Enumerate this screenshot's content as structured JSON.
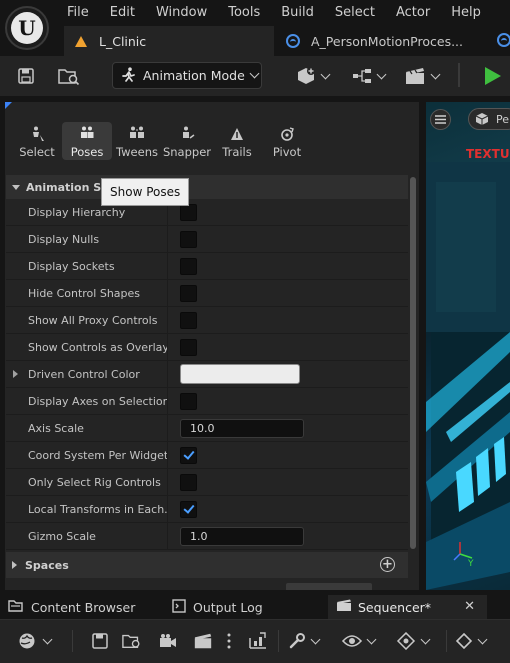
{
  "menu": [
    "File",
    "Edit",
    "Window",
    "Tools",
    "Build",
    "Select",
    "Actor",
    "Help"
  ],
  "doc_tabs": [
    {
      "label": "L_Clinic",
      "icon": "level-icon",
      "color": "#f1a230"
    },
    {
      "label": "A_PersonMotionProces...",
      "icon": "blueprint-icon",
      "color": "#4a8fe7"
    }
  ],
  "toolbar": {
    "mode_label": "Animation Mode"
  },
  "tools": [
    {
      "label": "Select",
      "icon": "select-icon"
    },
    {
      "label": "Poses",
      "icon": "poses-icon",
      "active": true
    },
    {
      "label": "Tweens",
      "icon": "tweens-icon"
    },
    {
      "label": "Snapper",
      "icon": "snapper-icon"
    },
    {
      "label": "Trails",
      "icon": "trails-icon"
    },
    {
      "label": "Pivot",
      "icon": "pivot-icon"
    }
  ],
  "details": {
    "section_title": "Animation Set",
    "tooltip": "Show Poses",
    "rows": [
      {
        "label": "Display Hierarchy",
        "type": "check",
        "value": false
      },
      {
        "label": "Display Nulls",
        "type": "check",
        "value": false
      },
      {
        "label": "Display Sockets",
        "type": "check",
        "value": false
      },
      {
        "label": "Hide Control Shapes",
        "type": "check",
        "value": false
      },
      {
        "label": "Show All Proxy Controls",
        "type": "check",
        "value": false
      },
      {
        "label": "Show Controls as Overlay",
        "type": "check",
        "value": false
      },
      {
        "label": "Driven Control Color",
        "type": "color",
        "value": "#ececec"
      },
      {
        "label": "Display Axes on Selection",
        "type": "check",
        "value": false
      },
      {
        "label": "Axis Scale",
        "type": "number",
        "value": "10.0"
      },
      {
        "label": "Coord System Per Widget...",
        "type": "check",
        "value": true
      },
      {
        "label": "Only Select Rig Controls",
        "type": "check",
        "value": false
      },
      {
        "label": "Local Transforms in Each...",
        "type": "check",
        "value": true
      },
      {
        "label": "Gizmo Scale",
        "type": "number",
        "value": "1.0"
      }
    ],
    "spaces_label": "Spaces"
  },
  "viewport": {
    "persp_label": "Pe",
    "overlay_text": "TEXTUR"
  },
  "bottom_tabs": {
    "content_browser": "Content Browser",
    "output_log": "Output Log",
    "sequencer": "Sequencer*"
  },
  "colors": {
    "accent": "#4a9eff",
    "play": "#3fbf3f",
    "brand_corner": "#3b82f6"
  }
}
